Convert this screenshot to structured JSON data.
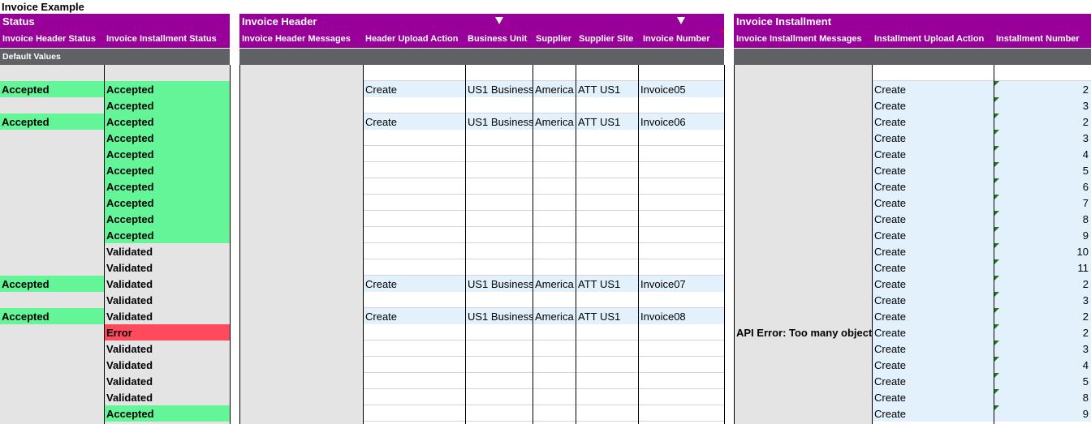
{
  "sheet": {
    "title": "Invoice Example"
  },
  "sections": {
    "status": {
      "title": "Status",
      "headers": [
        "Invoice Header Status",
        "Invoice Installment Status"
      ],
      "default_label": "Default Values"
    },
    "invoice_header": {
      "title": "Invoice Header",
      "headers": [
        "Invoice Header Messages",
        "Header Upload Action",
        "Business Unit",
        "Supplier",
        "Supplier Site",
        "Invoice Number"
      ]
    },
    "invoice_installment": {
      "title": "Invoice Installment",
      "headers": [
        "Invoice Installment Messages",
        "Installment Upload Action",
        "Installment Number"
      ]
    }
  },
  "colors": {
    "band": "#990099",
    "gray_band": "#5f6164",
    "accepted": "#63f597",
    "error": "#ff4a5e",
    "input": "#e2f1fb"
  },
  "rows": [
    {
      "hs": "Accepted",
      "is": "Accepted",
      "act": "Create",
      "bu": "US1 Business",
      "sup": "America",
      "site": "ATT US1",
      "inv": "Invoice05",
      "msg": "",
      "iact": "Create",
      "num": "2"
    },
    {
      "hs": "",
      "is": "Accepted",
      "act": "",
      "bu": "",
      "sup": "",
      "site": "",
      "inv": "",
      "msg": "",
      "iact": "Create",
      "num": "3"
    },
    {
      "hs": "Accepted",
      "is": "Accepted",
      "act": "Create",
      "bu": "US1 Business",
      "sup": "America",
      "site": "ATT US1",
      "inv": "Invoice06",
      "msg": "",
      "iact": "Create",
      "num": "2"
    },
    {
      "hs": "",
      "is": "Accepted",
      "act": "",
      "bu": "",
      "sup": "",
      "site": "",
      "inv": "",
      "msg": "",
      "iact": "Create",
      "num": "3"
    },
    {
      "hs": "",
      "is": "Accepted",
      "act": "",
      "bu": "",
      "sup": "",
      "site": "",
      "inv": "",
      "msg": "",
      "iact": "Create",
      "num": "4"
    },
    {
      "hs": "",
      "is": "Accepted",
      "act": "",
      "bu": "",
      "sup": "",
      "site": "",
      "inv": "",
      "msg": "",
      "iact": "Create",
      "num": "5"
    },
    {
      "hs": "",
      "is": "Accepted",
      "act": "",
      "bu": "",
      "sup": "",
      "site": "",
      "inv": "",
      "msg": "",
      "iact": "Create",
      "num": "6"
    },
    {
      "hs": "",
      "is": "Accepted",
      "act": "",
      "bu": "",
      "sup": "",
      "site": "",
      "inv": "",
      "msg": "",
      "iact": "Create",
      "num": "7"
    },
    {
      "hs": "",
      "is": "Accepted",
      "act": "",
      "bu": "",
      "sup": "",
      "site": "",
      "inv": "",
      "msg": "",
      "iact": "Create",
      "num": "8"
    },
    {
      "hs": "",
      "is": "Accepted",
      "act": "",
      "bu": "",
      "sup": "",
      "site": "",
      "inv": "",
      "msg": "",
      "iact": "Create",
      "num": "9"
    },
    {
      "hs": "",
      "is": "Validated",
      "act": "",
      "bu": "",
      "sup": "",
      "site": "",
      "inv": "",
      "msg": "",
      "iact": "Create",
      "num": "10"
    },
    {
      "hs": "",
      "is": "Validated",
      "act": "",
      "bu": "",
      "sup": "",
      "site": "",
      "inv": "",
      "msg": "",
      "iact": "Create",
      "num": "11"
    },
    {
      "hs": "Accepted",
      "is": "Validated",
      "act": "Create",
      "bu": "US1 Business",
      "sup": "America",
      "site": "ATT US1",
      "inv": "Invoice07",
      "msg": "",
      "iact": "Create",
      "num": "2"
    },
    {
      "hs": "",
      "is": "Validated",
      "act": "",
      "bu": "",
      "sup": "",
      "site": "",
      "inv": "",
      "msg": "",
      "iact": "Create",
      "num": "3"
    },
    {
      "hs": "Accepted",
      "is": "Validated",
      "act": "Create",
      "bu": "US1 Business",
      "sup": "America",
      "site": "ATT US1",
      "inv": "Invoice08",
      "msg": "",
      "iact": "Create",
      "num": "2"
    },
    {
      "hs": "",
      "is": "Error",
      "act": "",
      "bu": "",
      "sup": "",
      "site": "",
      "inv": "",
      "msg": "API Error: Too many objects",
      "iact": "Create",
      "num": "2"
    },
    {
      "hs": "",
      "is": "Validated",
      "act": "",
      "bu": "",
      "sup": "",
      "site": "",
      "inv": "",
      "msg": "",
      "iact": "Create",
      "num": "3"
    },
    {
      "hs": "",
      "is": "Validated",
      "act": "",
      "bu": "",
      "sup": "",
      "site": "",
      "inv": "",
      "msg": "",
      "iact": "Create",
      "num": "4"
    },
    {
      "hs": "",
      "is": "Validated",
      "act": "",
      "bu": "",
      "sup": "",
      "site": "",
      "inv": "",
      "msg": "",
      "iact": "Create",
      "num": "5"
    },
    {
      "hs": "",
      "is": "Validated",
      "act": "",
      "bu": "",
      "sup": "",
      "site": "",
      "inv": "",
      "msg": "",
      "iact": "Create",
      "num": "8"
    },
    {
      "hs": "",
      "is": "Accepted",
      "act": "",
      "bu": "",
      "sup": "",
      "site": "",
      "inv": "",
      "msg": "",
      "iact": "Create",
      "num": "9"
    }
  ]
}
